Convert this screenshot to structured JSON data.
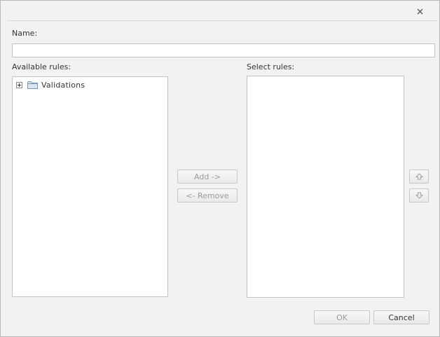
{
  "dialog": {
    "close_icon": "close-icon"
  },
  "name_field": {
    "label": "Name:",
    "value": "",
    "placeholder": ""
  },
  "available_rules": {
    "label": "Available rules:",
    "tree": [
      {
        "label": "Validations",
        "expander_icon": "plus-box-icon",
        "folder_icon": "folder-icon",
        "expanded": false
      }
    ]
  },
  "selected_rules": {
    "label": "Select rules:",
    "items": []
  },
  "transfer": {
    "add_label": "Add ->",
    "remove_label": "<- Remove"
  },
  "reorder": {
    "up_icon": "arrow-up-icon",
    "down_icon": "arrow-down-icon"
  },
  "footer": {
    "ok_label": "OK",
    "cancel_label": "Cancel"
  },
  "colors": {
    "dialog_bg": "#f2f2f2",
    "panel_bg": "#ffffff",
    "border": "#c3c3c3",
    "text": "#333333",
    "disabled_text": "#9a9a9a",
    "folder": "#a9c1dc"
  }
}
